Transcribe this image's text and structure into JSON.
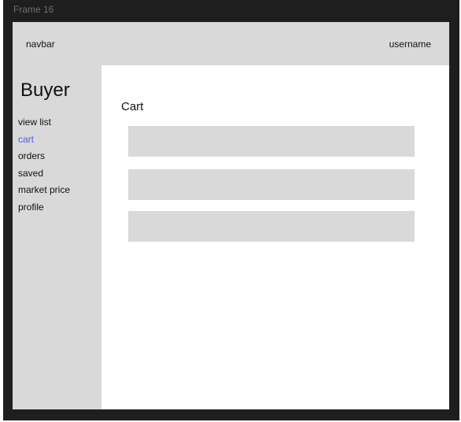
{
  "frame_label": "Frame 16",
  "navbar": {
    "title": "navbar",
    "username": "username"
  },
  "sidebar": {
    "heading": "Buyer",
    "items": [
      {
        "label": "view list",
        "active": false
      },
      {
        "label": "cart",
        "active": true
      },
      {
        "label": "orders",
        "active": false
      },
      {
        "label": "saved",
        "active": false
      },
      {
        "label": "market price",
        "active": false
      },
      {
        "label": "profile",
        "active": false
      }
    ]
  },
  "main": {
    "title": "Cart",
    "cart_items": 3
  },
  "colors": {
    "canvas": "#1e1e1e",
    "panel": "#d9d9d9",
    "active_link": "#4a5cf2"
  }
}
